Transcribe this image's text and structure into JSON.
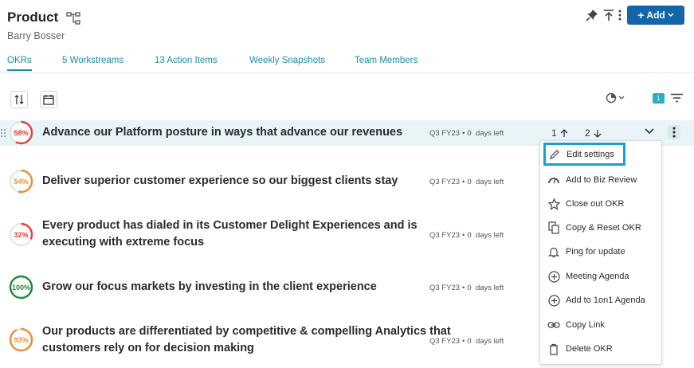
{
  "header": {
    "title": "Product",
    "subtitle": "Barry Bosser",
    "add_label": "Add"
  },
  "tabs": [
    {
      "label": "OKRs"
    },
    {
      "label": "5 Workstreams"
    },
    {
      "label": "13 Action Items"
    },
    {
      "label": "Weekly Snapshots"
    },
    {
      "label": "Team Members"
    }
  ],
  "toolbar": {
    "filter_count": "1"
  },
  "okrs": [
    {
      "title": "Advance our Platform posture in ways that advance our revenues",
      "progress": 58,
      "progress_label": "58%",
      "color": "#e0403a",
      "quarter": "Q3 FY23",
      "days": "0",
      "days_label": "days left"
    },
    {
      "title": "Deliver superior customer experience so our biggest clients stay",
      "progress": 54,
      "progress_label": "54%",
      "color": "#f08a2e",
      "quarter": "Q3 FY23",
      "days": "0",
      "days_label": "days left"
    },
    {
      "title_line1": "Every product has dialed in its Customer Delight Experiences and is",
      "title_line2": "executing with extreme focus",
      "progress": 32,
      "progress_label": "32%",
      "color": "#e0403a",
      "quarter": "Q3 FY23",
      "days": "0",
      "days_label": "days left"
    },
    {
      "title": "Grow our focus markets by investing in the client experience",
      "progress": 100,
      "progress_label": "100%",
      "color": "#1e8a3a",
      "quarter": "Q3 FY23",
      "days": "0",
      "days_label": "days left"
    },
    {
      "title_line1": "Our products are differentiated by competitive & compelling Analytics that",
      "title_line2": "customers rely on for decision making",
      "progress": 93,
      "progress_label": "93%",
      "color": "#f08a2e",
      "quarter": "Q3 FY23",
      "days": "0",
      "days_label": "days left"
    }
  ],
  "rank": {
    "up_value": "1",
    "down_value": "2"
  },
  "menu": [
    {
      "label": "Edit settings",
      "icon": "pencil-icon"
    },
    {
      "label": "Add to Biz Review",
      "icon": "gauge-icon"
    },
    {
      "label": "Close out OKR",
      "icon": "star-icon"
    },
    {
      "label": "Copy & Reset OKR",
      "icon": "copy-icon"
    },
    {
      "label": "Ping for update",
      "icon": "bell-icon"
    },
    {
      "label": "Meeting Agenda",
      "icon": "plus-circle-icon"
    },
    {
      "label": "Add to 1on1 Agenda",
      "icon": "plus-circle-icon"
    },
    {
      "label": "Copy Link",
      "icon": "link-icon"
    },
    {
      "label": "Delete OKR",
      "icon": "trash-icon"
    }
  ],
  "colors": {
    "accent": "#1a8fa4",
    "primary_button": "#1566a9",
    "row_highlight": "#e8f4f8",
    "focus_ring": "#1a9fd0"
  }
}
